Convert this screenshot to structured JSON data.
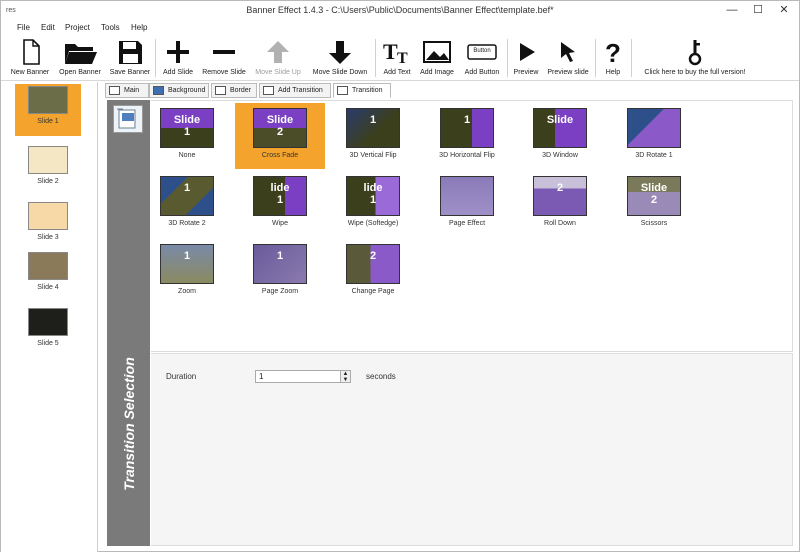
{
  "window": {
    "app_icon": "res",
    "title": "Banner Effect 1.4.3 - C:\\Users\\Public\\Documents\\Banner Effect\\template.bef*",
    "controls": [
      "—",
      "☐",
      "✕"
    ]
  },
  "menu": [
    "File",
    "Edit",
    "Project",
    "Tools",
    "Help"
  ],
  "toolbar": {
    "new_banner": "New Banner",
    "open_banner": "Open Banner",
    "save_banner": "Save Banner",
    "add_slide": "Add Slide",
    "remove_slide": "Remove Slide",
    "move_slide_up": "Move Slide Up",
    "move_slide_down": "Move Slide Down",
    "add_text": "Add Text",
    "add_image": "Add Image",
    "add_button": "Add Button",
    "add_button_icon_text": "Button",
    "preview": "Preview",
    "preview_slide": "Preview slide",
    "help": "Help",
    "buy": "Click here to buy the full version!"
  },
  "slides": [
    {
      "label": "Slide 1",
      "selected": true
    },
    {
      "label": "Slide 2",
      "selected": false
    },
    {
      "label": "Slide 3",
      "selected": false
    },
    {
      "label": "Slide 4",
      "selected": false
    },
    {
      "label": "Slide 5",
      "selected": false
    }
  ],
  "tabs": [
    {
      "label": "Main",
      "active": false
    },
    {
      "label": "Background",
      "active": false
    },
    {
      "label": "Border",
      "active": false
    },
    {
      "label": "Add Transition",
      "active": false
    },
    {
      "label": "Transition",
      "active": true
    }
  ],
  "side_title": "Transition Selection",
  "transitions": [
    {
      "name": "None",
      "text": "Slide\n1",
      "selected": false
    },
    {
      "name": "Cross Fade",
      "text": "Slide\n2",
      "selected": true
    },
    {
      "name": "3D Vertical Flip",
      "text": "1",
      "selected": false
    },
    {
      "name": "3D Horizontal Flip",
      "text": "1",
      "selected": false
    },
    {
      "name": "3D Window",
      "text": "Slide",
      "selected": false
    },
    {
      "name": "3D Rotate 1",
      "text": "",
      "selected": false
    },
    {
      "name": "3D Rotate 2",
      "text": "1",
      "selected": false
    },
    {
      "name": "Wipe",
      "text": "lide\n1",
      "selected": false
    },
    {
      "name": "Wipe (Softedge)",
      "text": "lide\n1",
      "selected": false
    },
    {
      "name": "Page Effect",
      "text": "",
      "selected": false
    },
    {
      "name": "Roll Down",
      "text": "2",
      "selected": false
    },
    {
      "name": "Scissors",
      "text": "Slide\n2",
      "selected": false
    },
    {
      "name": "Zoom",
      "text": "1",
      "selected": false
    },
    {
      "name": "Page Zoom",
      "text": "1",
      "selected": false
    },
    {
      "name": "Change Page",
      "text": "2",
      "selected": false
    }
  ],
  "duration": {
    "label": "Duration",
    "value": "1",
    "unit": "seconds"
  },
  "colors": {
    "selection": "#f4a42c",
    "side_strip": "#7a7a7a",
    "thumb_purple": "#6d3aa8",
    "thumb_olive": "#3c3f1c",
    "thumb_blue": "#2d4f8a"
  }
}
